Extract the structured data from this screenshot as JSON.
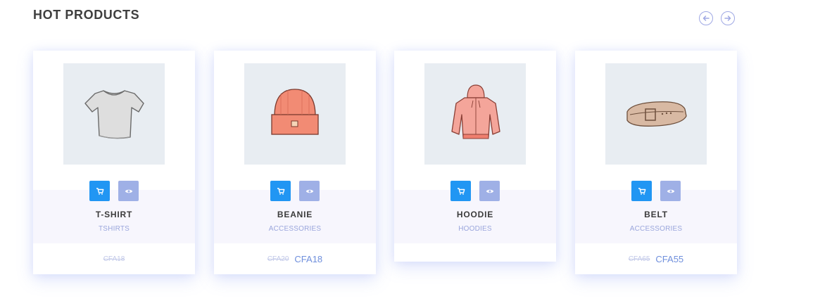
{
  "section": {
    "title": "HOT PRODUCTS"
  },
  "nav": {
    "prev_icon": "arrow-left-icon",
    "next_icon": "arrow-right-icon"
  },
  "colors": {
    "cart_button": "#2196f3",
    "view_button": "#9fb0e6",
    "price": "#6f8fdc",
    "info_band": "#f7f6fd"
  },
  "products": [
    {
      "name": "T-SHIRT",
      "category": "TSHIRTS",
      "old_price": "CFA18",
      "price": "",
      "image": "tshirt-illustration"
    },
    {
      "name": "BEANIE",
      "category": "ACCESSORIES",
      "old_price": "CFA20",
      "price": "CFA18",
      "image": "beanie-illustration"
    },
    {
      "name": "HOODIE",
      "category": "HOODIES",
      "old_price": "",
      "price": "",
      "image": "hoodie-illustration"
    },
    {
      "name": "BELT",
      "category": "ACCESSORIES",
      "old_price": "CFA65",
      "price": "CFA55",
      "image": "belt-illustration"
    }
  ]
}
